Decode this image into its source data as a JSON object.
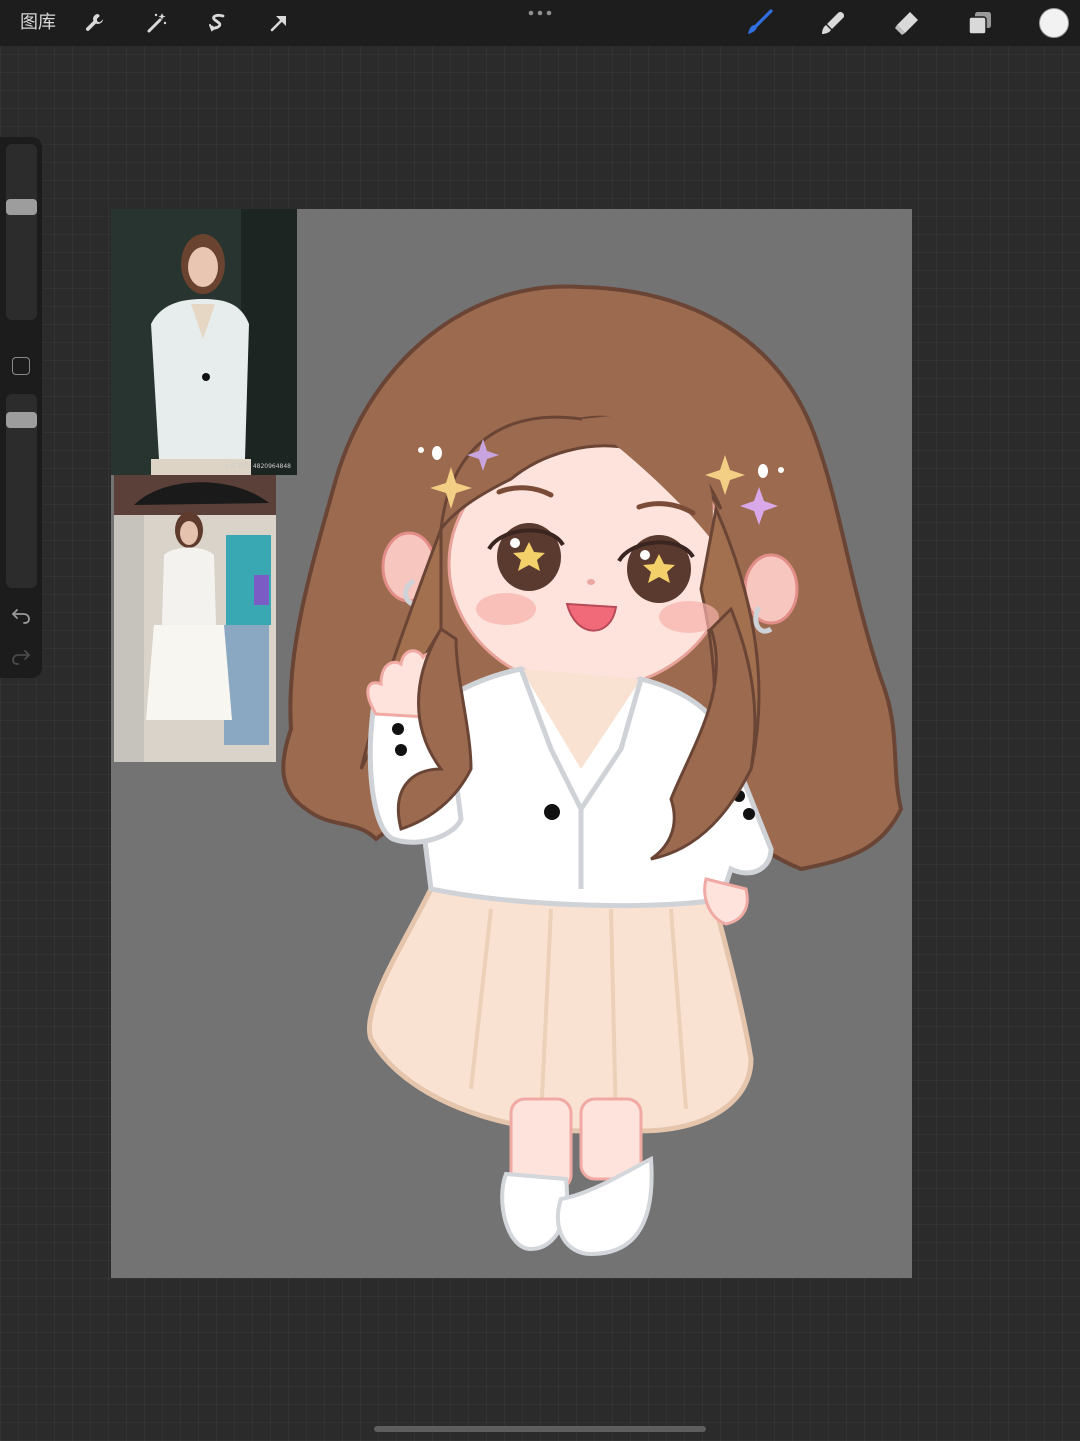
{
  "toolbar": {
    "gallery_label": "图库",
    "left_tools": [
      "wrench-icon",
      "magic-wand-icon",
      "selection-s-icon",
      "transform-arrow-icon"
    ],
    "right_tools": [
      "brush-icon",
      "smudge-icon",
      "eraser-icon",
      "layers-icon"
    ],
    "active_tool": "brush",
    "active_color": "#2f6fe0",
    "current_color": "#f2f2f2"
  },
  "sidebar": {
    "brush_size_level": 0.37,
    "opacity_level": 0.1,
    "icons": [
      "modify-square-icon",
      "undo-icon",
      "redo-icon"
    ]
  },
  "canvas": {
    "background": "#737373",
    "reference_photo_1_caption": "小红书号: 4820964848"
  }
}
